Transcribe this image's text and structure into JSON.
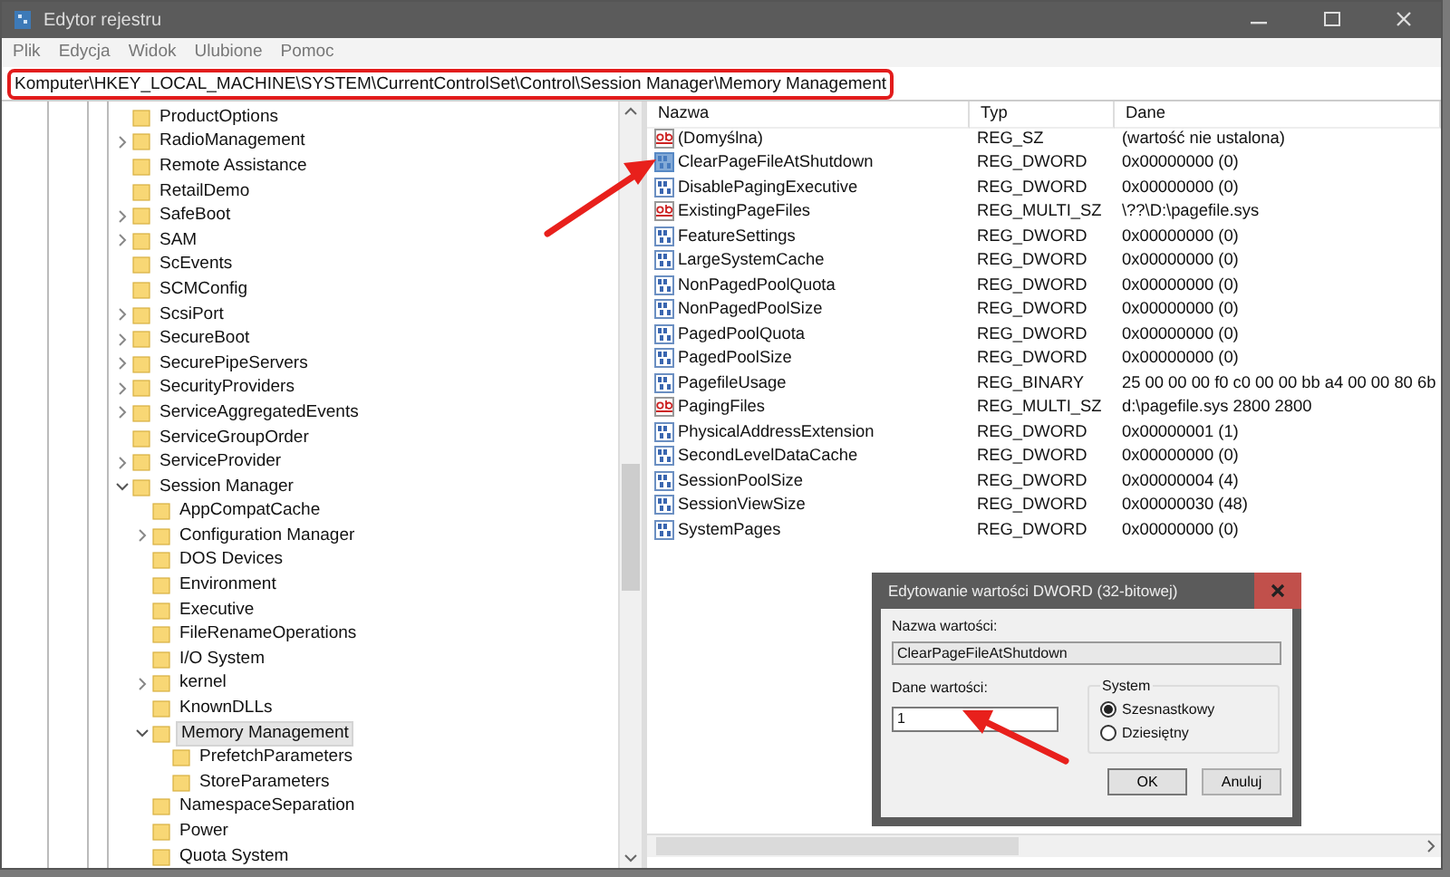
{
  "window": {
    "title": "Edytor rejestru"
  },
  "menu": [
    "Plik",
    "Edycja",
    "Widok",
    "Ulubione",
    "Pomoc"
  ],
  "address": "Komputer\\HKEY_LOCAL_MACHINE\\SYSTEM\\CurrentControlSet\\Control\\Session Manager\\Memory Management",
  "tree": [
    {
      "label": "ProductOptions"
    },
    {
      "label": "RadioManagement",
      "expanded": false
    },
    {
      "label": "Remote Assistance"
    },
    {
      "label": "RetailDemo"
    },
    {
      "label": "SafeBoot",
      "expanded": false
    },
    {
      "label": "SAM",
      "expanded": false
    },
    {
      "label": "ScEvents"
    },
    {
      "label": "SCMConfig"
    },
    {
      "label": "ScsiPort",
      "expanded": false
    },
    {
      "label": "SecureBoot",
      "expanded": false
    },
    {
      "label": "SecurePipeServers",
      "expanded": false
    },
    {
      "label": "SecurityProviders",
      "expanded": false
    },
    {
      "label": "ServiceAggregatedEvents",
      "expanded": false
    },
    {
      "label": "ServiceGroupOrder"
    },
    {
      "label": "ServiceProvider",
      "expanded": false
    },
    {
      "label": "Session Manager",
      "expanded": true,
      "children": [
        {
          "label": "AppCompatCache"
        },
        {
          "label": "Configuration Manager",
          "expanded": false
        },
        {
          "label": "DOS Devices"
        },
        {
          "label": "Environment"
        },
        {
          "label": "Executive"
        },
        {
          "label": "FileRenameOperations"
        },
        {
          "label": "I/O System"
        },
        {
          "label": "kernel",
          "expanded": false
        },
        {
          "label": "KnownDLLs"
        },
        {
          "label": "Memory Management",
          "expanded": true,
          "selected": true,
          "children": [
            {
              "label": "PrefetchParameters"
            },
            {
              "label": "StoreParameters"
            }
          ]
        },
        {
          "label": "NamespaceSeparation"
        },
        {
          "label": "Power"
        },
        {
          "label": "Quota System"
        }
      ]
    }
  ],
  "table": {
    "columns": [
      "Nazwa",
      "Typ",
      "Dane"
    ],
    "rows": [
      {
        "kind": "string",
        "selected": false,
        "name": "(Domyślna)",
        "type": "REG_SZ",
        "data": "(wartość nie ustalona)"
      },
      {
        "kind": "binary",
        "selected": true,
        "name": "ClearPageFileAtShutdown",
        "type": "REG_DWORD",
        "data": "0x00000000 (0)"
      },
      {
        "kind": "binary",
        "selected": false,
        "name": "DisablePagingExecutive",
        "type": "REG_DWORD",
        "data": "0x00000000 (0)"
      },
      {
        "kind": "string",
        "selected": false,
        "name": "ExistingPageFiles",
        "type": "REG_MULTI_SZ",
        "data": "\\??\\D:\\pagefile.sys"
      },
      {
        "kind": "binary",
        "selected": false,
        "name": "FeatureSettings",
        "type": "REG_DWORD",
        "data": "0x00000000 (0)"
      },
      {
        "kind": "binary",
        "selected": false,
        "name": "LargeSystemCache",
        "type": "REG_DWORD",
        "data": "0x00000000 (0)"
      },
      {
        "kind": "binary",
        "selected": false,
        "name": "NonPagedPoolQuota",
        "type": "REG_DWORD",
        "data": "0x00000000 (0)"
      },
      {
        "kind": "binary",
        "selected": false,
        "name": "NonPagedPoolSize",
        "type": "REG_DWORD",
        "data": "0x00000000 (0)"
      },
      {
        "kind": "binary",
        "selected": false,
        "name": "PagedPoolQuota",
        "type": "REG_DWORD",
        "data": "0x00000000 (0)"
      },
      {
        "kind": "binary",
        "selected": false,
        "name": "PagedPoolSize",
        "type": "REG_DWORD",
        "data": "0x00000000 (0)"
      },
      {
        "kind": "binary",
        "selected": false,
        "name": "PagefileUsage",
        "type": "REG_BINARY",
        "data": "25 00 00 00 f0 c0 00 00 bb a4 00 00 80 6b"
      },
      {
        "kind": "string",
        "selected": false,
        "name": "PagingFiles",
        "type": "REG_MULTI_SZ",
        "data": "d:\\pagefile.sys 2800 2800"
      },
      {
        "kind": "binary",
        "selected": false,
        "name": "PhysicalAddressExtension",
        "type": "REG_DWORD",
        "data": "0x00000001 (1)"
      },
      {
        "kind": "binary",
        "selected": false,
        "name": "SecondLevelDataCache",
        "type": "REG_DWORD",
        "data": "0x00000000 (0)"
      },
      {
        "kind": "binary",
        "selected": false,
        "name": "SessionPoolSize",
        "type": "REG_DWORD",
        "data": "0x00000004 (4)"
      },
      {
        "kind": "binary",
        "selected": false,
        "name": "SessionViewSize",
        "type": "REG_DWORD",
        "data": "0x00000030 (48)"
      },
      {
        "kind": "binary",
        "selected": false,
        "name": "SystemPages",
        "type": "REG_DWORD",
        "data": "0x00000000 (0)"
      }
    ]
  },
  "dialog": {
    "title": "Edytowanie wartości DWORD (32-bitowej)",
    "name_label": "Nazwa wartości:",
    "name_value": "ClearPageFileAtShutdown",
    "data_label": "Dane wartości:",
    "data_value": "1",
    "group_label": "System",
    "radios": [
      {
        "label": "Szesnastkowy",
        "selected": true
      },
      {
        "label": "Dziesiętny",
        "selected": false
      }
    ],
    "buttons": [
      "OK",
      "Anuluj"
    ]
  }
}
